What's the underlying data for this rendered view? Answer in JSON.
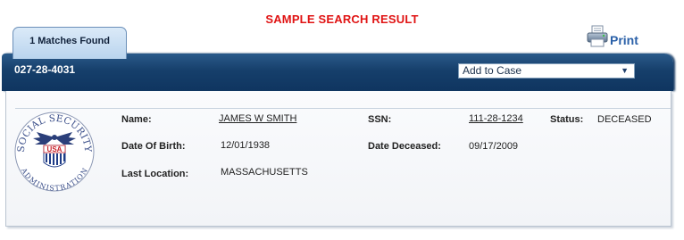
{
  "page": {
    "heading": "SAMPLE SEARCH RESULT"
  },
  "tab": {
    "label": "1 Matches Found"
  },
  "print": {
    "label": "Print",
    "icon": "printer-icon"
  },
  "record": {
    "id": "027-28-4031",
    "action_select": {
      "selected": "Add to Case"
    }
  },
  "details": {
    "seal": {
      "icon": "social-security-administration-seal",
      "top_text": "SOCIAL SECURITY",
      "bottom_text": "ADMINISTRATION",
      "center_text": "USA"
    },
    "name": {
      "label": "Name:",
      "value": "JAMES W SMITH"
    },
    "ssn": {
      "label": "SSN:",
      "value": "111-28-1234"
    },
    "status": {
      "label": "Status:",
      "value": "DECEASED"
    },
    "dob": {
      "label": "Date Of Birth:",
      "value": "12/01/1938"
    },
    "date_deceased": {
      "label": "Date Deceased:",
      "value": "09/17/2009"
    },
    "last_location": {
      "label": "Last Location:",
      "value": "MASSACHUSETTS"
    }
  },
  "colors": {
    "heading": "#e01414",
    "header_bar": "#163f6b",
    "tab": "#c7ddf2",
    "print_text": "#2a60a8",
    "seal_red": "#c8232c",
    "seal_blue": "#1f3c87"
  }
}
